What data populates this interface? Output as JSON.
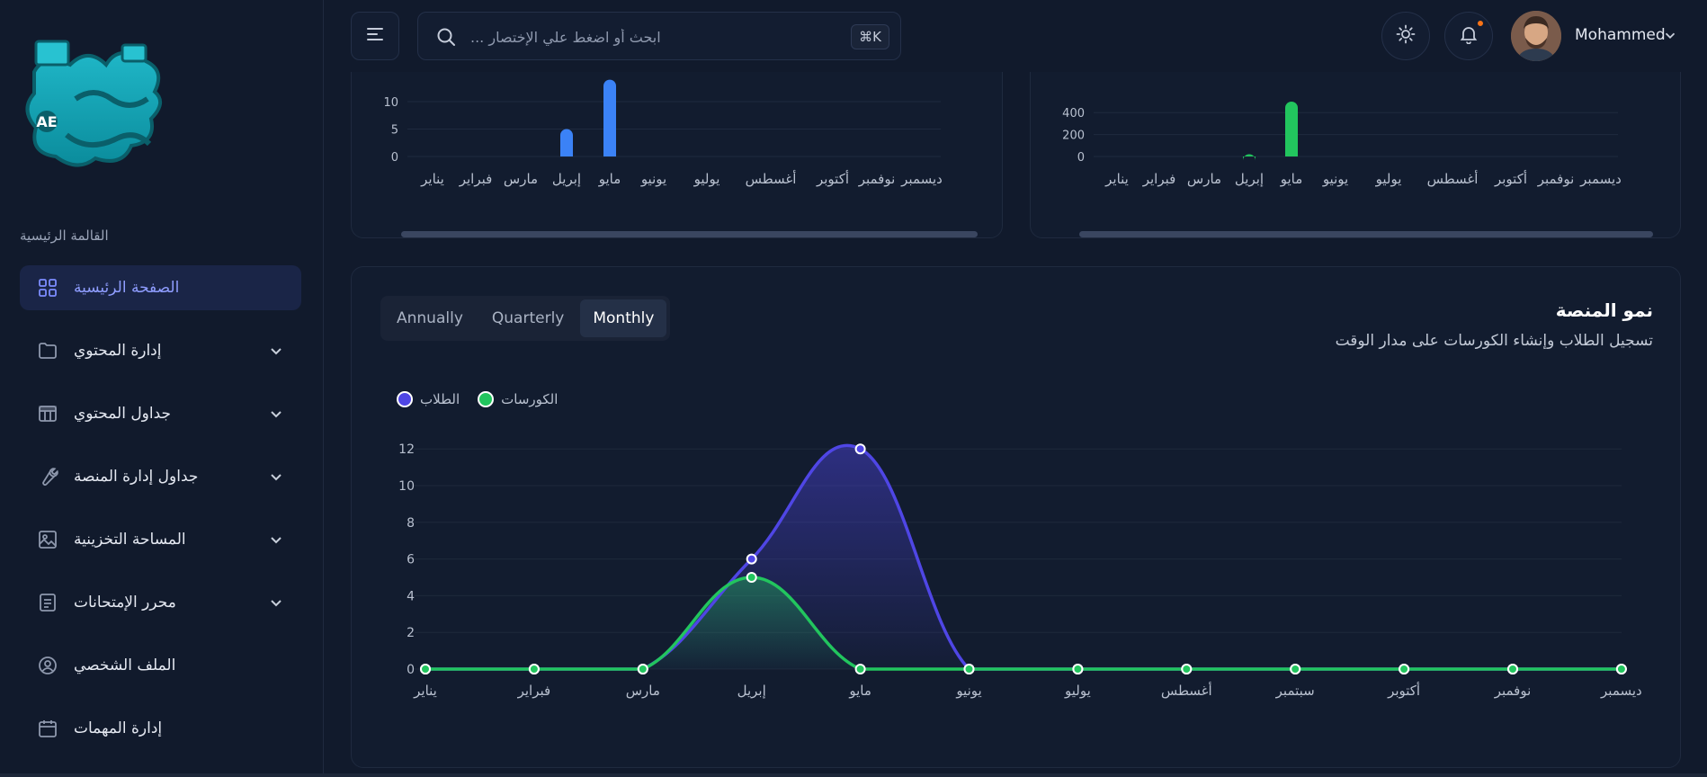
{
  "sidebar": {
    "logo_alt": "محمد هيكل AE",
    "menu_title": "القالمة الرئيسية",
    "items": [
      {
        "label": "الصفحة الرئيسية",
        "icon": "grid-icon",
        "active": true,
        "expandable": false
      },
      {
        "label": "إدارة المحتوي",
        "icon": "folder-icon",
        "active": false,
        "expandable": true
      },
      {
        "label": "جداول المحتوي",
        "icon": "table-icon",
        "active": false,
        "expandable": true
      },
      {
        "label": "جداول إدارة المنصة",
        "icon": "wrench-icon",
        "active": false,
        "expandable": true
      },
      {
        "label": "المساحة التخزينية",
        "icon": "image-icon",
        "active": false,
        "expandable": true
      },
      {
        "label": "محرر الإمتحانات",
        "icon": "document-icon",
        "active": false,
        "expandable": true
      },
      {
        "label": "الملف الشخصي",
        "icon": "user-circle-icon",
        "active": false,
        "expandable": false
      },
      {
        "label": "إدارة المهمات",
        "icon": "calendar-icon",
        "active": false,
        "expandable": false
      }
    ]
  },
  "header": {
    "search_placeholder": "ابحث أو اضغط علي الإختصار ...",
    "shortcut": "⌘K",
    "user_name": "Mohammed"
  },
  "colors": {
    "accent": "#7c8cff",
    "students": "#4f46e5",
    "courses": "#22c55e",
    "notification": "#f97316",
    "bar_blue": "#3b82f6"
  },
  "top_charts": {
    "left_yticks": [
      "10",
      "5",
      "0"
    ],
    "right_yticks": [
      "400",
      "200",
      "0"
    ],
    "months": [
      "يناير",
      "فبراير",
      "مارس",
      "إبريل",
      "مايو",
      "يونيو",
      "يوليو",
      "أغسطس",
      "أكتوبر",
      "نوفمبر",
      "ديسمبر"
    ]
  },
  "growth": {
    "title": "نمو المنصة",
    "subtitle": "تسجيل الطلاب وإنشاء الكورسات على مدار الوقت",
    "tabs": [
      "Annually",
      "Quarterly",
      "Monthly"
    ],
    "active_tab": "Monthly",
    "legend": {
      "students": "الطلاب",
      "courses": "الكورسات"
    }
  },
  "chart_data": [
    {
      "type": "bar",
      "categories": [
        "يناير",
        "فبراير",
        "مارس",
        "إبريل",
        "مايو",
        "يونيو",
        "يوليو",
        "أغسطس",
        "سبتمبر",
        "أكتوبر",
        "نوفمبر",
        "ديسمبر"
      ],
      "values": [
        0,
        0,
        0,
        5,
        14,
        0,
        0,
        0,
        0,
        0,
        0,
        0
      ],
      "ylim": [
        0,
        10
      ],
      "note": "clipped at top"
    },
    {
      "type": "bar",
      "categories": [
        "يناير",
        "فبراير",
        "مارس",
        "إبريل",
        "مايو",
        "يونيو",
        "يوليو",
        "أغسطس",
        "سبتمبر",
        "أكتوبر",
        "نوفمبر",
        "ديسمبر"
      ],
      "values": [
        0,
        0,
        0,
        20,
        500,
        0,
        0,
        0,
        0,
        0,
        0,
        0
      ],
      "ylim": [
        0,
        400
      ]
    },
    {
      "type": "area",
      "categories": [
        "يناير",
        "فبراير",
        "مارس",
        "إبريل",
        "مايو",
        "يونيو",
        "يوليو",
        "أغسطس",
        "سبتمبر",
        "أكتوبر",
        "نوفمبر",
        "ديسمبر"
      ],
      "series": [
        {
          "name": "الطلاب",
          "values": [
            0,
            0,
            0,
            6,
            12,
            0,
            0,
            0,
            0,
            0,
            0,
            0
          ]
        },
        {
          "name": "الكورسات",
          "values": [
            0,
            0,
            0,
            5,
            0,
            0,
            0,
            0,
            0,
            0,
            0,
            0
          ]
        }
      ],
      "yticks": [
        0,
        2,
        4,
        6,
        8,
        10,
        12
      ],
      "ylim": [
        0,
        12
      ]
    }
  ]
}
